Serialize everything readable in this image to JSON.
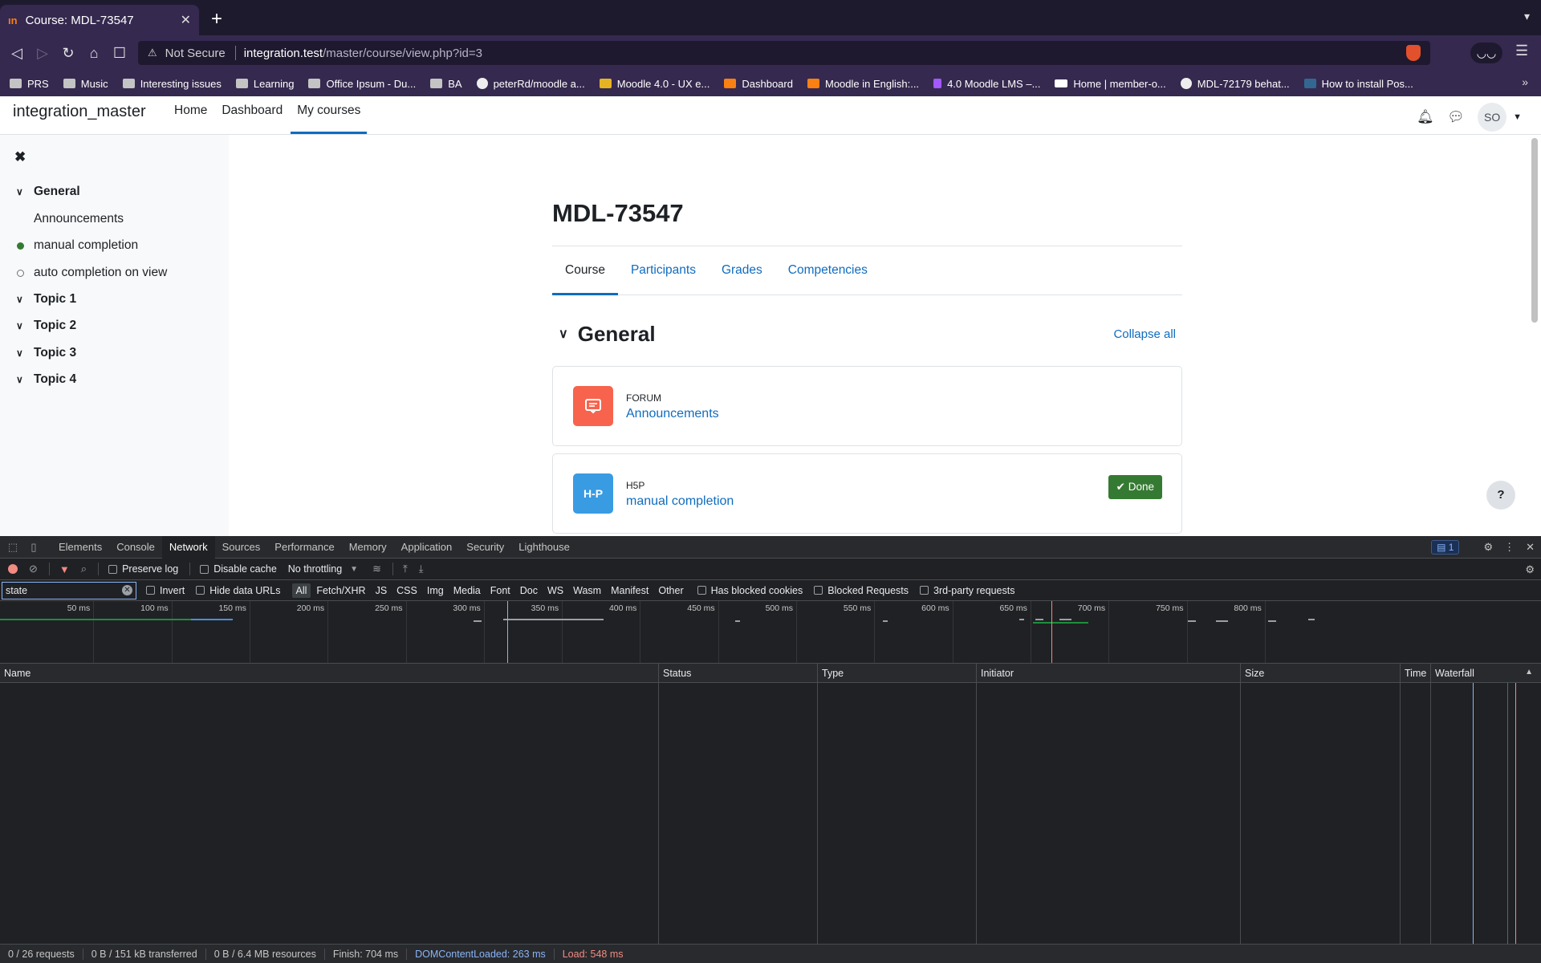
{
  "browser": {
    "tab_title": "Course: MDL-73547",
    "tab_favicon": "ın",
    "url_warning": "Not Secure",
    "url_host": "integration.test",
    "url_path": "/master/course/view.php?id=3",
    "bookmarks": [
      {
        "label": "PRS",
        "icon": "folder"
      },
      {
        "label": "Music",
        "icon": "folder"
      },
      {
        "label": "Interesting issues",
        "icon": "folder"
      },
      {
        "label": "Learning",
        "icon": "folder"
      },
      {
        "label": "Office Ipsum - Du...",
        "icon": "page"
      },
      {
        "label": "BA",
        "icon": "folder"
      },
      {
        "label": "peterRd/moodle a...",
        "icon": "github"
      },
      {
        "label": "Moodle 4.0 - UX e...",
        "icon": "yellow"
      },
      {
        "label": "Dashboard",
        "icon": "moodle"
      },
      {
        "label": "Moodle in English:...",
        "icon": "moodle"
      },
      {
        "label": "4.0 Moodle LMS –...",
        "icon": "figma"
      },
      {
        "label": "Home | member-o...",
        "icon": "wix"
      },
      {
        "label": "MDL-72179 behat...",
        "icon": "github"
      },
      {
        "label": "How to install Pos...",
        "icon": "postgres"
      }
    ]
  },
  "moodle": {
    "site_name": "integration_master",
    "nav": [
      "Home",
      "Dashboard",
      "My courses"
    ],
    "user_initials": "SO",
    "drawer": {
      "general": "General",
      "announcements": "Announcements",
      "manual": "manual completion",
      "auto": "auto completion on view",
      "topics": [
        "Topic 1",
        "Topic 2",
        "Topic 3",
        "Topic 4"
      ]
    },
    "course_title": "MDL-73547",
    "course_tabs": [
      "Course",
      "Participants",
      "Grades",
      "Competencies"
    ],
    "section_title": "General",
    "collapse_all": "Collapse all",
    "activities": [
      {
        "type": "FORUM",
        "name": "Announcements",
        "icon_text": ""
      },
      {
        "type": "H5P",
        "name": "manual completion",
        "icon_text": "H-P",
        "badge": "Done"
      }
    ],
    "help": "?"
  },
  "devtools": {
    "tabs": [
      "Elements",
      "Console",
      "Network",
      "Sources",
      "Performance",
      "Memory",
      "Application",
      "Security",
      "Lighthouse"
    ],
    "active_tab": "Network",
    "issues_count": "1",
    "preserve_log": "Preserve log",
    "disable_cache": "Disable cache",
    "throttling": "No throttling",
    "filter_value": "state",
    "invert": "Invert",
    "hide_data_urls": "Hide data URLs",
    "filter_types": [
      "All",
      "Fetch/XHR",
      "JS",
      "CSS",
      "Img",
      "Media",
      "Font",
      "Doc",
      "WS",
      "Wasm",
      "Manifest",
      "Other"
    ],
    "has_blocked_cookies": "Has blocked cookies",
    "blocked_requests": "Blocked Requests",
    "third_party": "3rd-party requests",
    "timeline_labels": [
      "50 ms",
      "100 ms",
      "150 ms",
      "200 ms",
      "250 ms",
      "300 ms",
      "350 ms",
      "400 ms",
      "450 ms",
      "500 ms",
      "550 ms",
      "600 ms",
      "650 ms",
      "700 ms",
      "750 ms",
      "800 ms"
    ],
    "columns": [
      "Name",
      "Status",
      "Type",
      "Initiator",
      "Size",
      "Time",
      "Waterfall"
    ],
    "status": {
      "requests": "0 / 26 requests",
      "transferred": "0 B / 151 kB transferred",
      "resources": "0 B / 6.4 MB resources",
      "finish": "Finish: 704 ms",
      "dcl": "DOMContentLoaded: 263 ms",
      "load": "Load: 548 ms"
    },
    "colors": {
      "accent": "#8ab4f8",
      "load": "#f28b82"
    }
  }
}
